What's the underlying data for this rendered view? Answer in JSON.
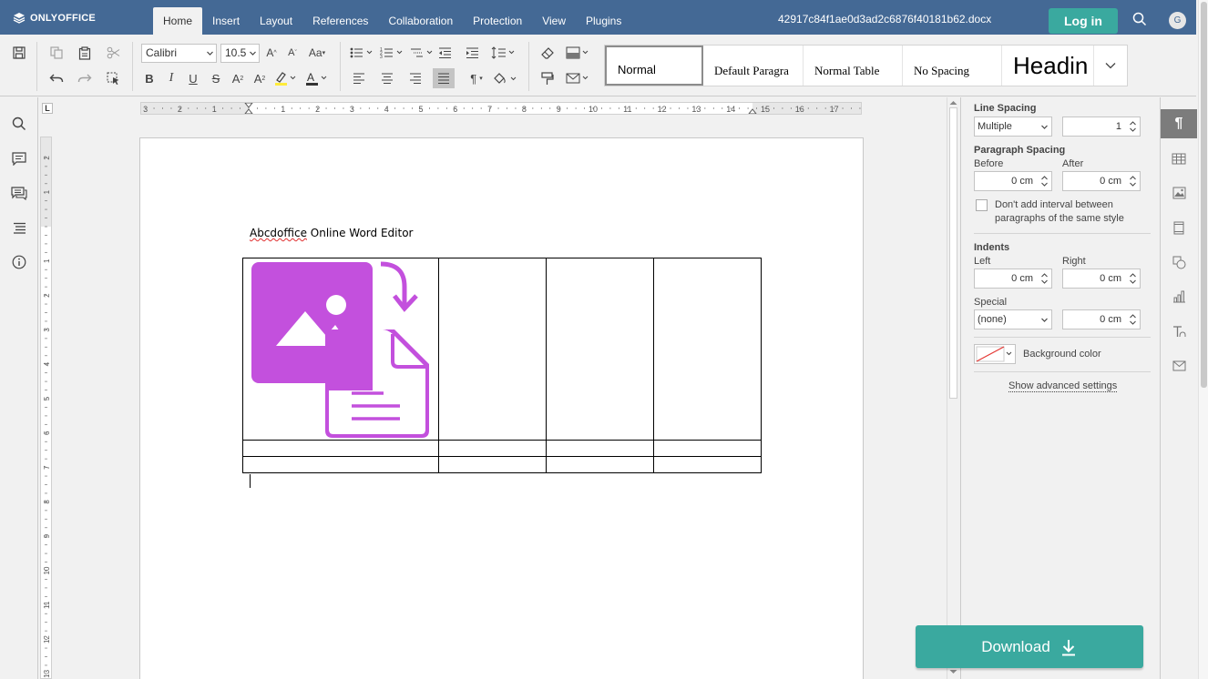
{
  "app": {
    "brand": "ONLYOFFICE",
    "document_title": "42917c84f1ae0d3ad2c6876f40181b62.docx",
    "login_label": "Log in",
    "avatar_initial": "G"
  },
  "tabs": [
    {
      "label": "Home",
      "active": true
    },
    {
      "label": "Insert"
    },
    {
      "label": "Layout"
    },
    {
      "label": "References"
    },
    {
      "label": "Collaboration"
    },
    {
      "label": "Protection"
    },
    {
      "label": "View"
    },
    {
      "label": "Plugins"
    }
  ],
  "toolbar": {
    "font_name": "Calibri",
    "font_size": "10.5",
    "styles": [
      {
        "label": "Normal",
        "selected": true
      },
      {
        "label": "Default Paragra"
      },
      {
        "label": "Normal Table"
      },
      {
        "label": "No Spacing"
      },
      {
        "label": "Headin"
      }
    ]
  },
  "document": {
    "spellcheck_word": "Abcdoffice",
    "rest_of_line": " Online Word Editor",
    "image_color": "#c350dd"
  },
  "ruler": {
    "h_labels": [
      "3",
      "2",
      "1",
      "1",
      "2",
      "3",
      "4",
      "5",
      "6",
      "7",
      "8",
      "9",
      "10",
      "11",
      "12",
      "13",
      "14",
      "15",
      "16",
      "17"
    ],
    "v_labels": [
      "2",
      "1",
      "1",
      "2",
      "3",
      "4",
      "5",
      "6",
      "7",
      "8",
      "9",
      "10",
      "11",
      "12",
      "13"
    ]
  },
  "panel": {
    "line_spacing_label": "Line Spacing",
    "line_spacing_mode": "Multiple",
    "line_spacing_value": "1",
    "paragraph_spacing_label": "Paragraph Spacing",
    "before_label": "Before",
    "before_value": "0 cm",
    "after_label": "After",
    "after_value": "0 cm",
    "dont_add_interval": "Don't add interval between",
    "dont_add_interval_2": "paragraphs of the same style",
    "indents_label": "Indents",
    "left_label": "Left",
    "left_value": "0 cm",
    "right_label": "Right",
    "right_value": "0 cm",
    "special_label": "Special",
    "special_value": "(none)",
    "special_amount": "0 cm",
    "background_color_label": "Background color",
    "advanced_settings_link": "Show advanced settings"
  },
  "download_label": "Download",
  "colors": {
    "header": "#446995",
    "accent": "#3aa99f",
    "image": "#c350dd"
  }
}
